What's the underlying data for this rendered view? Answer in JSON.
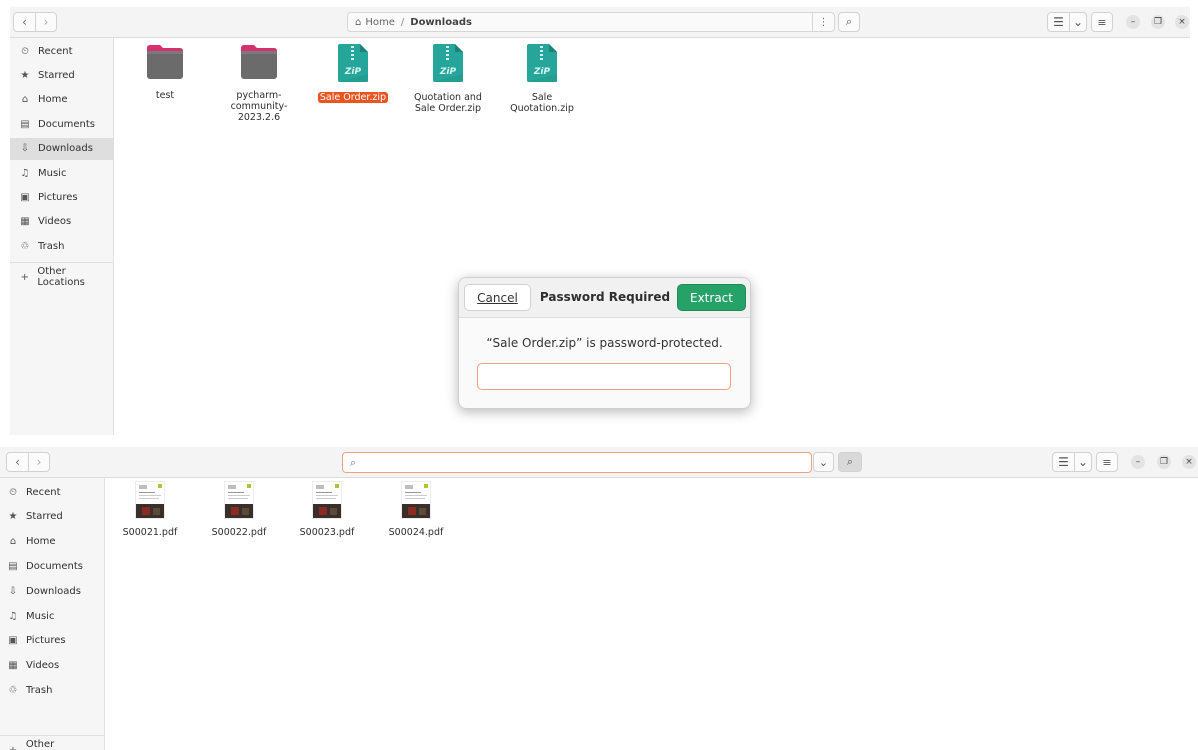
{
  "window1": {
    "path": {
      "home_label": "Home",
      "separator": "/",
      "current": "Downloads"
    },
    "sidebar": [
      {
        "icon": "clock-icon",
        "glyph": "⏲",
        "label": "Recent"
      },
      {
        "icon": "star-icon",
        "glyph": "★",
        "label": "Starred"
      },
      {
        "icon": "home-icon",
        "glyph": "⌂",
        "label": "Home"
      },
      {
        "icon": "document-icon",
        "glyph": "▤",
        "label": "Documents"
      },
      {
        "icon": "download-icon",
        "glyph": "⇩",
        "label": "Downloads",
        "active": true
      },
      {
        "icon": "music-icon",
        "glyph": "♫",
        "label": "Music"
      },
      {
        "icon": "picture-icon",
        "glyph": "▣",
        "label": "Pictures"
      },
      {
        "icon": "video-icon",
        "glyph": "▦",
        "label": "Videos"
      },
      {
        "icon": "trash-icon",
        "glyph": "♲",
        "label": "Trash"
      }
    ],
    "other_locations": {
      "icon": "plus-icon",
      "glyph": "+",
      "label": "Other Locations"
    },
    "files": [
      {
        "type": "folder",
        "color": "#d5316c",
        "name": "test"
      },
      {
        "type": "folder",
        "color": "#d5316c",
        "name": "pycharm-community-2023.2.6"
      },
      {
        "type": "zip",
        "name": "Sale Order.zip",
        "selected": true
      },
      {
        "type": "zip",
        "name": "Quotation and Sale Order.zip"
      },
      {
        "type": "zip",
        "name": "Sale Quotation.zip"
      }
    ],
    "zip_label": "ZiP"
  },
  "dialog": {
    "cancel_label": "Cancel",
    "title": "Password Required",
    "extract_label": "Extract",
    "message": "“Sale Order.zip” is password-protected.",
    "password_value": ""
  },
  "window2": {
    "sidebar": [
      {
        "icon": "clock-icon",
        "glyph": "⏲",
        "label": "Recent"
      },
      {
        "icon": "star-icon",
        "glyph": "★",
        "label": "Starred"
      },
      {
        "icon": "home-icon",
        "glyph": "⌂",
        "label": "Home"
      },
      {
        "icon": "document-icon",
        "glyph": "▤",
        "label": "Documents"
      },
      {
        "icon": "download-icon",
        "glyph": "⇩",
        "label": "Downloads"
      },
      {
        "icon": "music-icon",
        "glyph": "♫",
        "label": "Music"
      },
      {
        "icon": "picture-icon",
        "glyph": "▣",
        "label": "Pictures"
      },
      {
        "icon": "video-icon",
        "glyph": "▦",
        "label": "Videos"
      },
      {
        "icon": "trash-icon",
        "glyph": "♲",
        "label": "Trash"
      }
    ],
    "other_locations": {
      "icon": "plus-icon",
      "glyph": "+",
      "label": "Other Locations"
    },
    "search_value": "",
    "files": [
      {
        "name": "S00021.pdf"
      },
      {
        "name": "S00022.pdf"
      },
      {
        "name": "S00023.pdf"
      },
      {
        "name": "S00024.pdf"
      }
    ]
  },
  "colors": {
    "accent": "#e95420",
    "extract": "#26a269",
    "zip": "#26a69a",
    "folder_tab": "#d5316c"
  }
}
